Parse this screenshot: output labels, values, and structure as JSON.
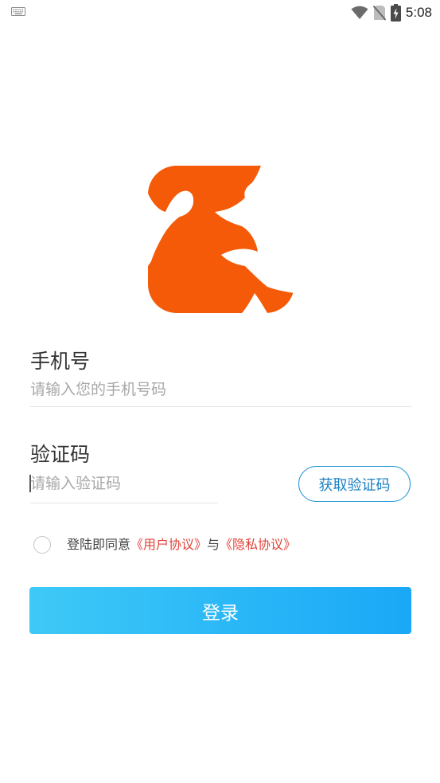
{
  "status_bar": {
    "time": "5:08",
    "icons": [
      "keyboard-icon",
      "wifi-icon",
      "no-sim-icon",
      "battery-charging-icon"
    ]
  },
  "logo": {
    "name": "app-logo",
    "color": "#f45a08"
  },
  "phone": {
    "label": "手机号",
    "placeholder": "请输入您的手机号码"
  },
  "code": {
    "label": "验证码",
    "placeholder": "请输入验证码",
    "get_code_label": "获取验证码"
  },
  "agreement": {
    "prefix": "登陆即同意",
    "user_agreement": "《用户协议》",
    "joiner": "与",
    "privacy_agreement": "《隐私协议》"
  },
  "login_button": "登录",
  "colors": {
    "accent": "#1aa8f7",
    "link_red": "#e0443a",
    "logo_orange": "#f45a08"
  }
}
